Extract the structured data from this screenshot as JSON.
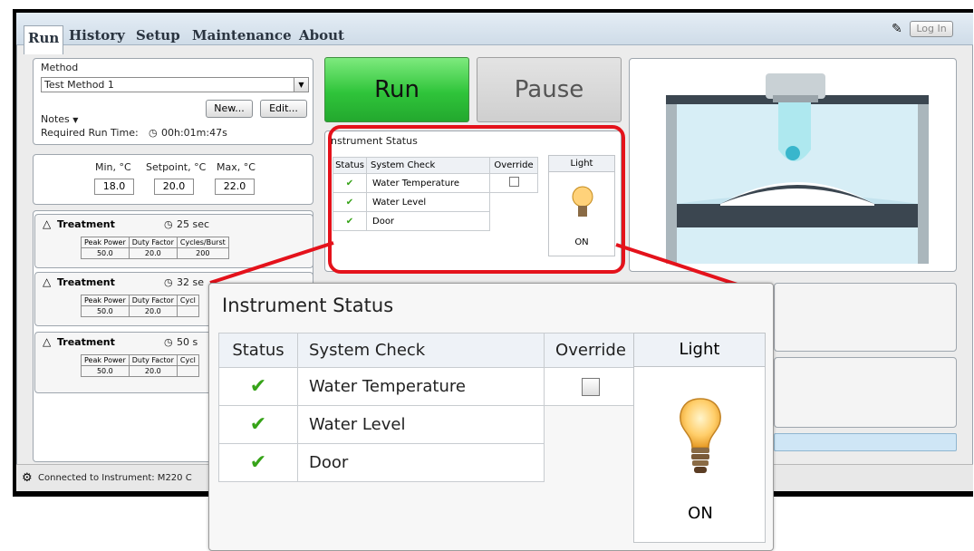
{
  "menu": {
    "tabs": [
      "Run",
      "History",
      "Setup",
      "Maintenance",
      "About"
    ],
    "login_label": "Log In"
  },
  "method": {
    "label": "Method",
    "selected": "Test Method 1",
    "new_label": "New...",
    "edit_label": "Edit...",
    "notes_label": "Notes",
    "required_run_time_label": "Required Run Time:",
    "required_run_time_value": "00h:01m:47s"
  },
  "temperature": {
    "min_label": "Min, °C",
    "setpoint_label": "Setpoint, °C",
    "max_label": "Max, °C",
    "min": "18.0",
    "setpoint": "20.0",
    "max": "22.0"
  },
  "treatments": [
    {
      "label": "Treatment",
      "duration": "25 sec",
      "headers": [
        "Peak Power",
        "Duty Factor",
        "Cycles/Burst"
      ],
      "values": [
        "50.0",
        "20.0",
        "200"
      ]
    },
    {
      "label": "Treatment",
      "duration": "32 se",
      "headers": [
        "Peak Power",
        "Duty Factor",
        "Cycl"
      ],
      "values": [
        "50.0",
        "20.0",
        ""
      ]
    },
    {
      "label": "Treatment",
      "duration": "50 s",
      "headers": [
        "Peak Power",
        "Duty Factor",
        "Cycl"
      ],
      "values": [
        "50.0",
        "20.0",
        ""
      ]
    }
  ],
  "controls": {
    "run_label": "Run",
    "pause_label": "Pause"
  },
  "instrument_status": {
    "title": "Instrument Status",
    "small_title": "nstrument Status",
    "headers": {
      "status": "Status",
      "system_check": "System Check",
      "override": "Override",
      "light": "Light"
    },
    "rows": [
      {
        "status": "✔",
        "check": "Water Temperature"
      },
      {
        "status": "✔",
        "check": "Water Level"
      },
      {
        "status": "✔",
        "check": "Door"
      }
    ],
    "light_state": "ON"
  },
  "status_bar": {
    "text": "Connected to Instrument: M220 C"
  },
  "colors": {
    "run_green": "#2fc43a",
    "highlight_red": "#e4121b",
    "check_green": "#36a318"
  }
}
